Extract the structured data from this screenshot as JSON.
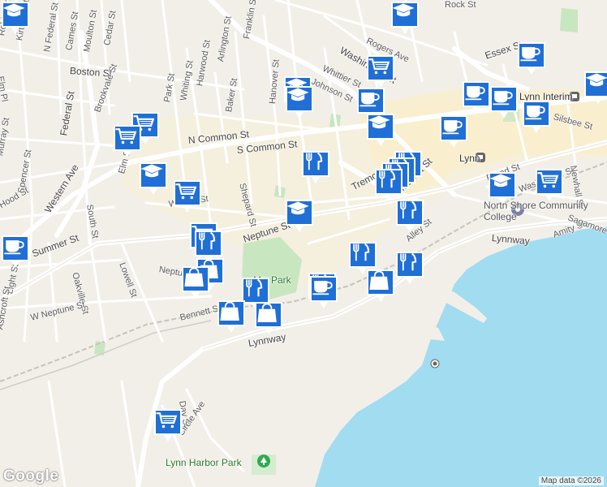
{
  "colors": {
    "land": "#f2efe9",
    "water": "#a2dcf0",
    "road": "#ffffff",
    "major_road": "#ffffff",
    "park": "#c8e6c0",
    "downtown": "#faf0d0",
    "marker_fill": "#1f6fd6",
    "marker_icon": "#ffffff",
    "rail": "#b8b8b8"
  },
  "street_labels": [
    "Robinson St",
    "Kirtland St",
    "N Federal St",
    "Cames St",
    "Moulton St",
    "Cedar St",
    "Boston St",
    "Brookvale St",
    "Federal St",
    "Whiting St",
    "Park St",
    "Harwood St",
    "Arlington St",
    "Franklin St",
    "Baker St",
    "Hanover St",
    "Whittier St",
    "Johnson St",
    "Washington St",
    "Rogers Ave",
    "Essex St",
    "Rock St",
    "N Common St",
    "S Common St",
    "Shepard St",
    "Murray St",
    "Spencer St",
    "Western Ave",
    "Elm St",
    "South St",
    "Warren St",
    "Summer St",
    "Neptune St",
    "Neptune Blvd",
    "Lowell St",
    "Oakville St",
    "Light St",
    "W Neptune St",
    "Bennett St",
    "Lynnway",
    "Lynnway",
    "Tremont St",
    "Market St",
    "Alley St",
    "Broad St",
    "Washington St",
    "Amity St",
    "Sagamore St",
    "Newhall St",
    "Silsbee St",
    "Day St",
    "Circle Ave",
    "Elm Pl",
    "Hood St",
    "Ashcroft St"
  ],
  "place_labels": {
    "lynn": "Lynn",
    "lynn_interim": "Lynn Interim",
    "north_shore_cc": "North Shore Community College",
    "park": "Lynn Common / McN Park",
    "park_visible": "Park",
    "park_prefix": "Mc",
    "lynn_harbor_park": "Lynn Harbor Park"
  },
  "markers": [
    {
      "type": "education",
      "icon": "graduation-cap-icon"
    },
    {
      "type": "education",
      "icon": "graduation-cap-icon"
    },
    {
      "type": "cafe",
      "icon": "coffee-cup-icon"
    },
    {
      "type": "grocery",
      "icon": "shopping-cart-icon"
    },
    {
      "type": "education",
      "icon": "graduation-cap-icon"
    },
    {
      "type": "education",
      "icon": "graduation-cap-icon"
    },
    {
      "type": "cafe",
      "icon": "coffee-cup-icon"
    },
    {
      "type": "cafe",
      "icon": "coffee-cup-icon"
    },
    {
      "type": "cafe",
      "icon": "coffee-cup-icon"
    },
    {
      "type": "cafe",
      "icon": "coffee-cup-icon"
    },
    {
      "type": "cafe",
      "icon": "coffee-cup-icon"
    },
    {
      "type": "education",
      "icon": "graduation-cap-icon"
    },
    {
      "type": "cafe",
      "icon": "coffee-cup-icon"
    },
    {
      "type": "education",
      "icon": "graduation-cap-icon"
    },
    {
      "type": "grocery",
      "icon": "shopping-cart-icon"
    },
    {
      "type": "grocery",
      "icon": "shopping-cart-icon"
    },
    {
      "type": "education",
      "icon": "graduation-cap-icon"
    },
    {
      "type": "restaurant",
      "icon": "fork-knife-icon"
    },
    {
      "type": "restaurant",
      "icon": "fork-knife-icon"
    },
    {
      "type": "restaurant",
      "icon": "fork-knife-icon"
    },
    {
      "type": "restaurant",
      "icon": "fork-knife-icon"
    },
    {
      "type": "restaurant",
      "icon": "fork-knife-icon"
    },
    {
      "type": "grocery",
      "icon": "shopping-cart-icon"
    },
    {
      "type": "education",
      "icon": "graduation-cap-icon"
    },
    {
      "type": "grocery",
      "icon": "shopping-cart-icon"
    },
    {
      "type": "education",
      "icon": "graduation-cap-icon"
    },
    {
      "type": "restaurant",
      "icon": "fork-knife-icon"
    },
    {
      "type": "grocery",
      "icon": "shopping-cart-icon"
    },
    {
      "type": "restaurant",
      "icon": "fork-knife-icon"
    },
    {
      "type": "shopping",
      "icon": "shopping-bag-icon"
    },
    {
      "type": "shopping",
      "icon": "shopping-bag-icon"
    },
    {
      "type": "restaurant",
      "icon": "fork-knife-icon"
    },
    {
      "type": "restaurant",
      "icon": "fork-knife-icon"
    },
    {
      "type": "restaurant",
      "icon": "fork-knife-icon"
    },
    {
      "type": "restaurant",
      "icon": "fork-knife-icon"
    },
    {
      "type": "cafe",
      "icon": "coffee-cup-icon"
    },
    {
      "type": "shopping",
      "icon": "shopping-bag-icon"
    },
    {
      "type": "shopping",
      "icon": "shopping-bag-icon"
    },
    {
      "type": "shopping",
      "icon": "shopping-bag-icon"
    },
    {
      "type": "grocery",
      "icon": "shopping-cart-icon"
    }
  ],
  "attribution": "Map data ©2026",
  "logo": "Google"
}
